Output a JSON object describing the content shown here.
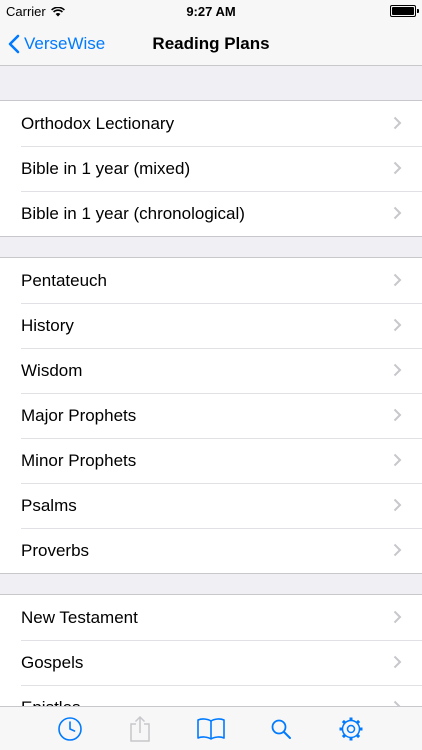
{
  "status_bar": {
    "carrier": "Carrier",
    "time": "9:27 AM"
  },
  "nav": {
    "back_label": "VerseWise",
    "title": "Reading Plans"
  },
  "sections": [
    {
      "items": [
        "Orthodox Lectionary",
        "Bible in 1 year (mixed)",
        "Bible in 1 year (chronological)"
      ]
    },
    {
      "items": [
        "Pentateuch",
        "History",
        "Wisdom",
        "Major Prophets",
        "Minor Prophets",
        "Psalms",
        "Proverbs"
      ]
    },
    {
      "items": [
        "New Testament",
        "Gospels",
        "Epistles"
      ]
    }
  ],
  "tab_bar": {
    "tabs": [
      {
        "icon": "clock-icon",
        "state": "enabled"
      },
      {
        "icon": "share-icon",
        "state": "disabled"
      },
      {
        "icon": "book-icon",
        "state": "enabled"
      },
      {
        "icon": "search-icon",
        "state": "enabled"
      },
      {
        "icon": "gear-icon",
        "state": "enabled"
      }
    ]
  },
  "colors": {
    "accent": "#007aff",
    "background": "#efeff4",
    "separator": "#c8c7cc",
    "chevron": "#c7c7cc",
    "disabled": "#c7c7cc"
  }
}
